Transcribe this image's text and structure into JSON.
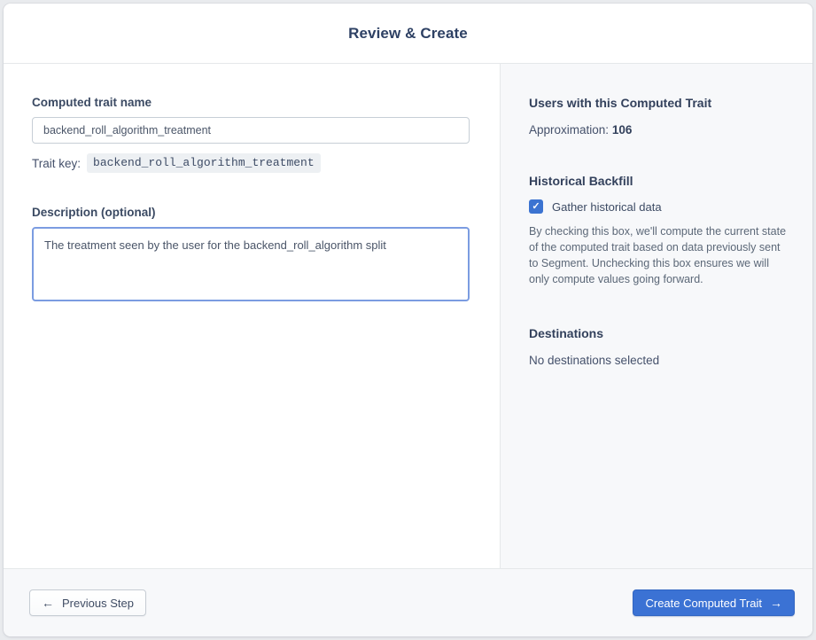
{
  "header": {
    "title": "Review & Create"
  },
  "form": {
    "name_label": "Computed trait name",
    "name_value": "backend_roll_algorithm_treatment",
    "trait_key_label": "Trait key:",
    "trait_key_value": "backend_roll_algorithm_treatment",
    "description_label": "Description (optional)",
    "description_value": "The treatment seen by the user for the backend_roll_algorithm split"
  },
  "sidebar": {
    "users_heading": "Users with this Computed Trait",
    "approximation_label": "Approximation:",
    "approximation_value": "106",
    "backfill_heading": "Historical Backfill",
    "backfill_checkbox_label": "Gather historical data",
    "backfill_checked": true,
    "backfill_description": "By checking this box, we'll compute the current state of the computed trait based on data previously sent to Segment. Unchecking this box ensures we will only compute values going forward.",
    "destinations_heading": "Destinations",
    "destinations_empty_text": "No destinations selected"
  },
  "footer": {
    "previous_label": "Previous Step",
    "create_label": "Create Computed Trait"
  },
  "icons": {
    "back_arrow": "←",
    "forward_arrow": "→",
    "check": "✓"
  },
  "colors": {
    "accent_blue": "#3b72d4",
    "checkbox_blue": "#3b73d1",
    "sidebar_background": "#f7f8fa",
    "heading_text": "#2e4164",
    "divider": "#e5e8ea",
    "badge_background": "#edf0f3"
  }
}
